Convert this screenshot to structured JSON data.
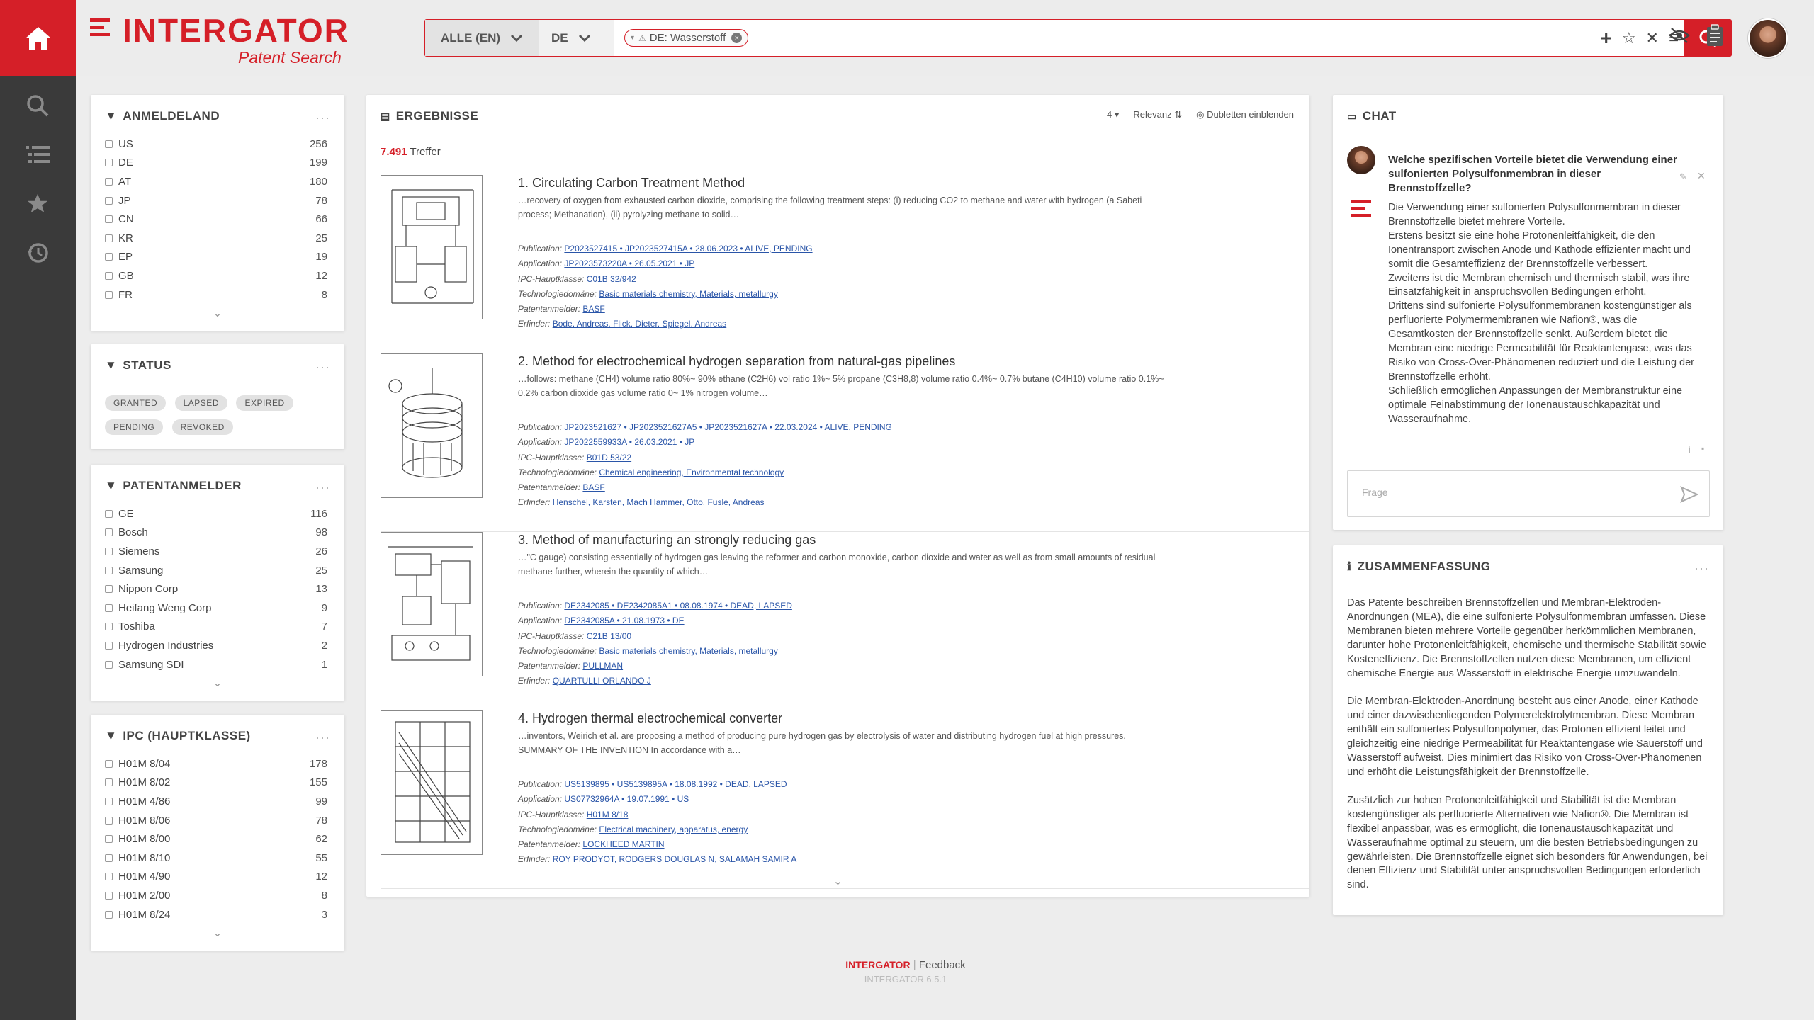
{
  "app": {
    "logo": "INTERGATOR",
    "subtitle": "Patent Search",
    "version": "INTERGATOR 6.5.1",
    "feedback": "Feedback"
  },
  "search": {
    "scope": "ALLE (EN)",
    "lang": "DE",
    "chip": "DE: Wasserstoff"
  },
  "facets": [
    {
      "title": "ANMELDELAND",
      "items": [
        {
          "label": "US",
          "count": "256"
        },
        {
          "label": "DE",
          "count": "199"
        },
        {
          "label": "AT",
          "count": "180"
        },
        {
          "label": "JP",
          "count": "78"
        },
        {
          "label": "CN",
          "count": "66"
        },
        {
          "label": "KR",
          "count": "25"
        },
        {
          "label": "EP",
          "count": "19"
        },
        {
          "label": "GB",
          "count": "12"
        },
        {
          "label": "FR",
          "count": "8"
        }
      ]
    },
    {
      "title": "STATUS",
      "tags": [
        "GRANTED",
        "LAPSED",
        "EXPIRED",
        "PENDING",
        "REVOKED"
      ]
    },
    {
      "title": "PATENTANMELDER",
      "items": [
        {
          "label": "GE",
          "count": "116"
        },
        {
          "label": "Bosch",
          "count": "98"
        },
        {
          "label": "Siemens",
          "count": "26"
        },
        {
          "label": "Samsung",
          "count": "25"
        },
        {
          "label": "Nippon Corp",
          "count": "13"
        },
        {
          "label": "Heifang Weng Corp",
          "count": "9"
        },
        {
          "label": "Toshiba",
          "count": "7"
        },
        {
          "label": "Hydrogen Industries",
          "count": "2"
        },
        {
          "label": "Samsung SDI",
          "count": "1"
        }
      ]
    },
    {
      "title": "IPC (HAUPTKLASSE)",
      "items": [
        {
          "label": "H01M 8/04",
          "count": "178"
        },
        {
          "label": "H01M 8/02",
          "count": "155"
        },
        {
          "label": "H01M 4/86",
          "count": "99"
        },
        {
          "label": "H01M 8/06",
          "count": "78"
        },
        {
          "label": "H01M 8/00",
          "count": "62"
        },
        {
          "label": "H01M 8/10",
          "count": "55"
        },
        {
          "label": "H01M 4/90",
          "count": "12"
        },
        {
          "label": "H01M 2/00",
          "count": "8"
        },
        {
          "label": "H01M 8/24",
          "count": "3"
        }
      ]
    }
  ],
  "results": {
    "title": "ERGEBNISSE",
    "count": "7.491",
    "count_label": "Treffer",
    "page_size": "4",
    "sort": "Relevanz",
    "duplicates": "Dubletten einblenden",
    "labels": {
      "publication": "Publication:",
      "application": "Application:",
      "ipc": "IPC-Hauptklasse:",
      "tech": "Technologiedomäne:",
      "applicant": "Patentanmelder:",
      "inventor": "Erfinder:"
    },
    "items": [
      {
        "title": "1. Circulating Carbon Treatment Method",
        "abstract": "…recovery of oxygen from exhausted carbon dioxide, comprising the following treatment steps: (i) reducing CO2 to methane and water with hydrogen (a Sabeti process; Methanation), (ii) pyrolyzing methane to solid…",
        "publication": "P2023527415 • JP2023527415A • 28.06.2023 • ALIVE, PENDING",
        "application": "JP2023573220A • 26.05.2021 • JP",
        "ipc": "C01B 32/942",
        "tech": "Basic materials chemistry, Materials, metallurgy",
        "applicant": "BASF",
        "inventor": "Bode, Andreas, Flick, Dieter, Spiegel, Andreas"
      },
      {
        "title": "2. Method for electrochemical hydrogen separation from natural-gas pipelines",
        "abstract": "…follows: methane (CH4) volume ratio 80%~ 90% ethane (C2H6) vol ratio 1%~ 5% propane (C3H8,8) volume ratio 0.4%~ 0.7% butane (C4H10) volume ratio 0.1%~ 0.2% carbon dioxide gas volume ratio 0~ 1% nitrogen volume…",
        "publication": "JP2023521627 • JP2023521627A5 • JP2023521627A • 22.03.2024 • ALIVE, PENDING",
        "application": "JP2022559933A • 26.03.2021 • JP",
        "ipc": "B01D 53/22",
        "tech": "Chemical engineering, Environmental technology",
        "applicant": "BASF",
        "inventor": "Henschel, Karsten, Mach Hammer, Otto, Fusle, Andreas"
      },
      {
        "title": "3. Method of manufacturing an strongly reducing gas",
        "abstract": "…\"C gauge) consisting essentially of hydrogen gas leaving the reformer and carbon monoxide, carbon dioxide and water as well as from small amounts of residual methane further, wherein the quantity of which…",
        "publication": "DE2342085 • DE2342085A1 • 08.08.1974 • DEAD, LAPSED",
        "application": "DE2342085A • 21.08.1973 • DE",
        "ipc": "C21B 13/00",
        "tech": "Basic materials chemistry, Materials, metallurgy",
        "applicant": "PULLMAN",
        "inventor": "QUARTULLI ORLANDO J"
      },
      {
        "title": "4. Hydrogen thermal electrochemical converter",
        "abstract": "…inventors, Weirich et al. are proposing a method of producing pure hydrogen gas by electrolysis of water and distributing hydrogen fuel at high pressures. SUMMARY OF THE INVENTION In accordance with a…",
        "publication": "US5139895 • US5139895A • 18.08.1992 • DEAD, LAPSED",
        "application": "US07732964A • 19.07.1991 • US",
        "ipc": "H01M 8/18",
        "tech": "Electrical machinery, apparatus, energy",
        "applicant": "LOCKHEED MARTIN",
        "inventor": "ROY PRODYOT, RODGERS DOUGLAS N, SALAMAH SAMIR A"
      }
    ]
  },
  "chat": {
    "title": "CHAT",
    "question": "Welche spezifischen Vorteile bietet die Verwendung einer sulfonierten Polysulfonmembran in dieser Brennstoffzelle?",
    "answer": "Die Verwendung einer sulfonierten Polysulfonmembran in dieser Brennstoffzelle bietet mehrere Vorteile.\nErstens besitzt sie eine hohe Protonenleitfähigkeit, die den Ionentransport zwischen Anode und Kathode effizienter macht und somit die Gesamteffizienz der Brennstoffzelle verbessert.\nZweitens ist die Membran chemisch und thermisch stabil, was ihre Einsatzfähigkeit in anspruchsvollen Bedingungen erhöht.\nDrittens sind sulfonierte Polysulfonmembranen kostengünstiger als perfluorierte Polymermembranen wie Nafion®, was die Gesamtkosten der Brennstoffzelle senkt. Außerdem bietet die Membran eine niedrige Permeabilität für Reaktantengase, was das Risiko von Cross-Over-Phänomenen reduziert und die Leistung der Brennstoffzelle erhöht.\nSchließlich ermöglichen Anpassungen der Membranstruktur eine optimale Feinabstimmung der Ionenaustauschkapazität und Wasseraufnahme.",
    "input_placeholder": "Frage"
  },
  "summary": {
    "title": "ZUSAMMENFASSUNG",
    "paragraphs": [
      "Das Patente beschreiben Brennstoffzellen und Membran-Elektroden-Anordnungen (MEA), die eine sulfonierte Polysulfonmembran umfassen. Diese Membranen bieten mehrere Vorteile gegenüber herkömmlichen Membranen, darunter hohe Protonenleitfähigkeit, chemische und thermische Stabilität sowie Kosteneffizienz. Die Brennstoffzellen nutzen diese Membranen, um effizient chemische Energie aus Wasserstoff in elektrische Energie umzuwandeln.",
      "Die Membran-Elektroden-Anordnung besteht aus einer Anode, einer Kathode und einer dazwischenliegenden Polymerelektrolytmembran. Diese Membran enthält ein sulfoniertes Polysulfonpolymer, das Protonen effizient leitet und gleichzeitig eine niedrige Permeabilität für Reaktantengase wie Sauerstoff und Wasserstoff aufweist. Dies minimiert das Risiko von Cross-Over-Phänomenen und erhöht die Leistungsfähigkeit der Brennstoffzelle.",
      "Zusätzlich zur hohen Protonenleitfähigkeit und Stabilität ist die Membran kostengünstiger als perfluorierte Alternativen wie Nafion®. Die Membran ist flexibel anpassbar, was es ermöglicht, die Ionenaustauschkapazität und Wasseraufnahme optimal zu steuern, um die besten Betriebsbedingungen zu gewährleisten. Die Brennstoffzelle eignet sich besonders für Anwendungen, bei denen Effizienz und Stabilität unter anspruchsvollen Bedingungen erforderlich sind."
    ]
  },
  "colors": {
    "accent": "#d51f28",
    "rail": "#3a3a3a",
    "link": "#2a55a8"
  }
}
